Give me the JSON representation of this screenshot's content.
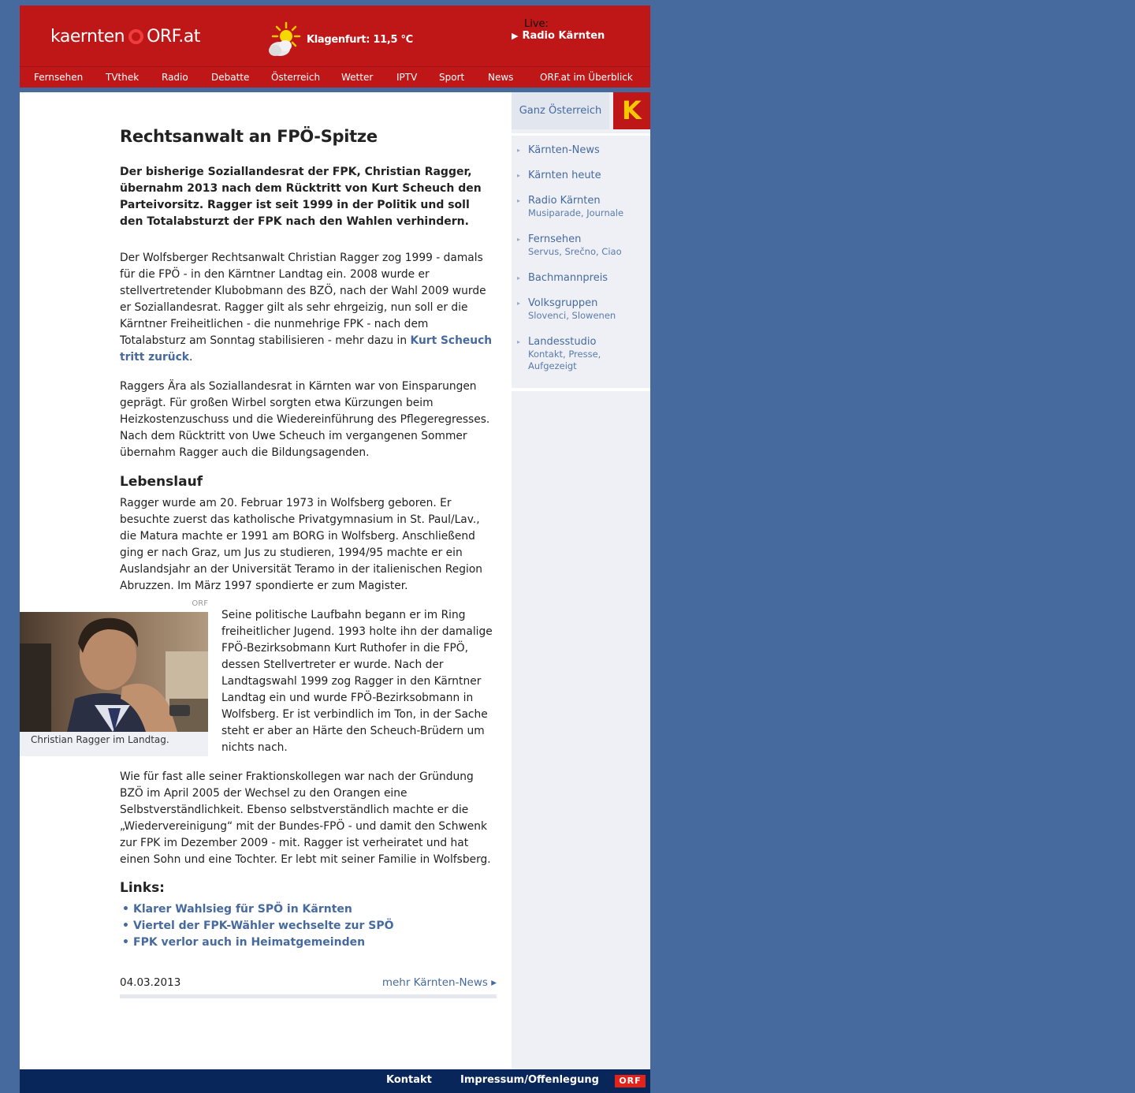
{
  "header": {
    "logo_word": "kaernten",
    "logo_orf": "ORF.at",
    "weather_text": "Klagenfurt: 11,5 °C",
    "live_label": "Live:",
    "live_station": "Radio Kärnten"
  },
  "nav": [
    "Fernsehen",
    "TVthek",
    "Radio",
    "Debatte",
    "Österreich",
    "Wetter",
    "IPTV",
    "Sport",
    "News",
    "ORF.at im Überblick"
  ],
  "sidebar": {
    "ganz": "Ganz Österreich",
    "k_letter": "K",
    "items": [
      {
        "label": "Kärnten-News",
        "sub": ""
      },
      {
        "label": "Kärnten heute",
        "sub": ""
      },
      {
        "label": "Radio Kärnten",
        "sub": "Musiparade,  Journale"
      },
      {
        "label": "Fernsehen",
        "sub": "Servus, Srečno, Ciao"
      },
      {
        "label": "Bachmannpreis",
        "sub": ""
      },
      {
        "label": "Volksgruppen",
        "sub": "Slovenci,  Slowenen"
      },
      {
        "label": "Landesstudio",
        "sub": "Kontakt,  Presse,\nAufgezeigt"
      }
    ]
  },
  "article": {
    "title": "Rechtsanwalt an FPÖ-Spitze",
    "lead": "Der bisherige Soziallandesrat der FPK, Christian Ragger, übernahm 2013 nach dem Rücktritt von Kurt Scheuch den Parteivorsitz. Ragger ist seit 1999 in der Politik und soll den Totalabsturzt der FPK nach den Wahlen verhindern.",
    "p1": "Der Wolfsberger Rechtsanwalt Christian Ragger zog 1999 - damals für die FPÖ - in den Kärntner Landtag ein. 2008 wurde er stellvertretender Klubobmann des BZÖ, nach der Wahl 2009 wurde er Soziallandesrat. Ragger gilt als sehr ehrgeizig, nun soll er die Kärntner Freiheitlichen - die nunmehrige FPK - nach dem Totalabsturz am Sonntag stabilisieren - mehr dazu in ",
    "p1_link": "Kurt Scheuch tritt zurück",
    "p1_end": ".",
    "p2": "Raggers Ära als Soziallandesrat in Kärnten war von Einsparungen geprägt. Für großen Wirbel sorgten etwa Kürzungen beim Heizkostenzuschuss und die Wiedereinführung des Pflegeregresses. Nach dem Rücktritt von Uwe Scheuch im vergangenen Sommer übernahm Ragger auch die Bildungsagenden.",
    "h_lebenslauf": "Lebenslauf",
    "p3": "Ragger wurde am 20. Februar 1973 in Wolfsberg geboren. Er besuchte zuerst das katholische Privatgymnasium in St. Paul/Lav., die Matura machte er 1991 am BORG in Wolfsberg. Anschließend ging er nach Graz, um Jus zu studieren, 1994/95 machte er ein Auslandsjahr an der Universität Teramo in der italienischen Region Abruzzen. Im März 1997 spondierte er zum Magister.",
    "fig_credit": "ORF",
    "fig_caption": "Christian Ragger im Landtag.",
    "p4": "Seine politische Laufbahn begann er im Ring freiheitlicher Jugend. 1993 holte ihn der damalige FPÖ-Bezirksobmann Kurt Ruthofer in die FPÖ, dessen Stellvertreter er wurde. Nach der Landtagswahl 1999 zog Ragger in den Kärntner Landtag ein und wurde FPÖ-Bezirksobmann in Wolfsberg. Er ist verbindlich im Ton, in der Sache steht er aber an Härte den Scheuch-Brüdern um nichts nach.",
    "p5": "Wie für fast alle seiner Fraktionskollegen war nach der Gründung BZÖ im April 2005 der Wechsel zu den Orangen eine Selbstverständlichkeit. Ebenso selbstverständlich machte er die „Wiedervereinigung“ mit der Bundes-FPÖ - und damit den Schwenk zur FPK im Dezember 2009 - mit. Ragger ist verheiratet und hat einen Sohn und eine Tochter. Er lebt mit seiner Familie in Wolfsberg.",
    "h_links": "Links:",
    "links": [
      "Klarer Wahlsieg für SPÖ in Kärnten",
      "Viertel der FPK-Wähler wechselte zur SPÖ",
      "FPK verlor auch in Heimatgemeinden"
    ],
    "date": "04.03.2013",
    "more": "mehr Kärnten-News ▸"
  },
  "footer": {
    "kontakt": "Kontakt",
    "impressum": "Impressum/Offenlegung",
    "orf": "ORF"
  },
  "colors": {
    "orf_red": "#bf1718",
    "page_blue": "#476a9e",
    "link_blue": "#476a9e",
    "footer_navy": "#08265a",
    "k_yellow": "#f5c800"
  }
}
